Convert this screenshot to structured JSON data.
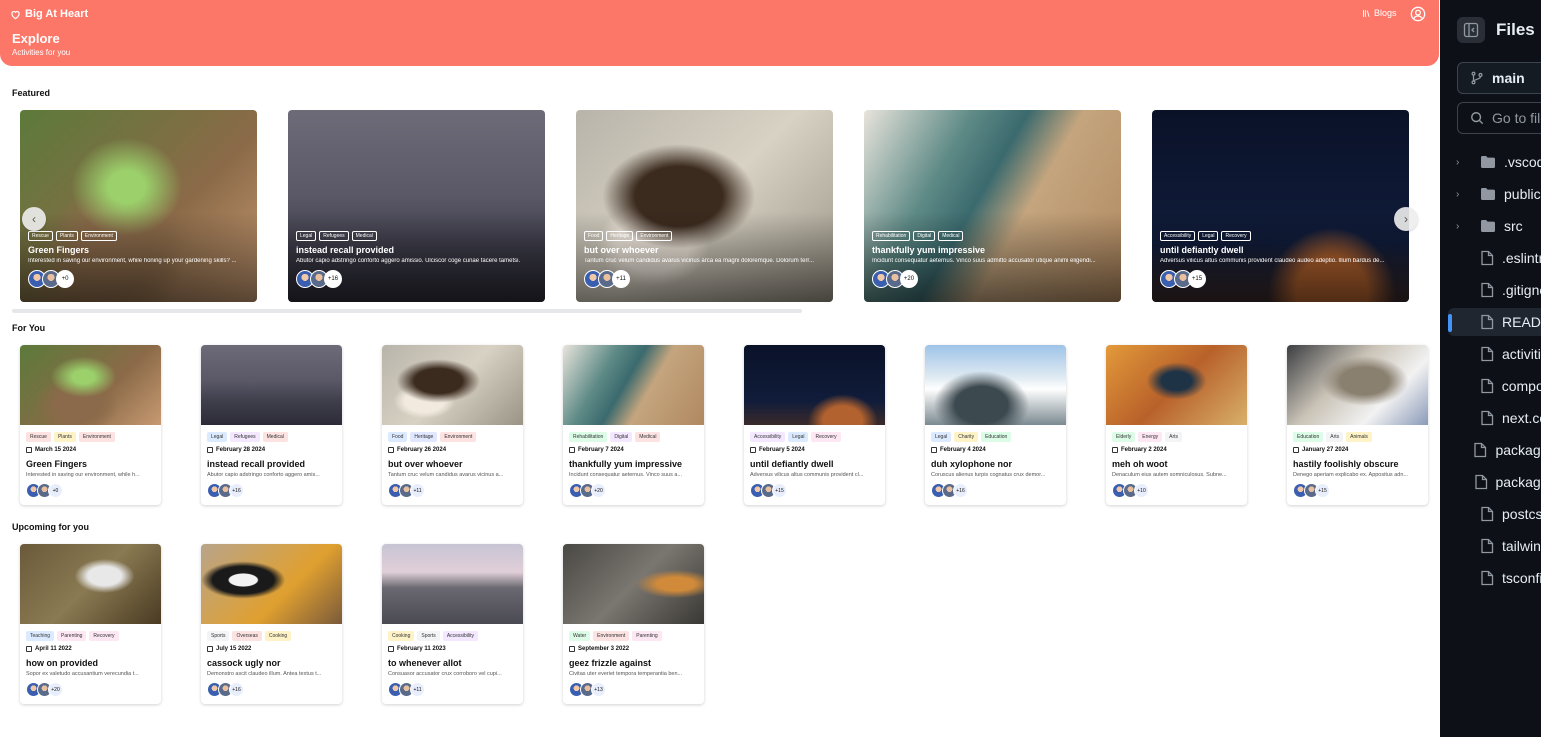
{
  "header": {
    "brand": "Big At Heart",
    "title": "Explore",
    "subtitle": "Activities for you",
    "blogs": "Blogs"
  },
  "sections": {
    "featured": "Featured",
    "for_you": "For You",
    "upcoming": "Upcoming for you"
  },
  "featured": [
    {
      "title": "Green Fingers",
      "desc": "Interested in saving our environment, while honing up your gardening skills? ...",
      "tags": [
        "Rescue",
        "Plants",
        "Environment"
      ],
      "count": "+0"
    },
    {
      "title": "instead recall provided",
      "desc": "Abutor capio adstringo conforto aggero amissio. Ulciscor coge cunae facere tametsi.",
      "tags": [
        "Legal",
        "Refugees",
        "Medical"
      ],
      "count": "+16"
    },
    {
      "title": "but over whoever",
      "desc": "Tantum cruc velum candidus avarus vicinus arca ea magni doloremque. Dolorum terr...",
      "tags": [
        "Food",
        "Heritage",
        "Environment"
      ],
      "count": "+11"
    },
    {
      "title": "thankfully yum impressive",
      "desc": "Incidunt consequatur aeternus. Vinco suus admitto accusator utique animi eligendi...",
      "tags": [
        "Rehabilitation",
        "Digital",
        "Medical"
      ],
      "count": "+20"
    },
    {
      "title": "until defiantly dwell",
      "desc": "Adversus vilicus altus communis provident claudeo audeo adeptio. Illum bardus de...",
      "tags": [
        "Accessibility",
        "Legal",
        "Recovery"
      ],
      "count": "+15"
    }
  ],
  "for_you": [
    {
      "title": "Green Fingers",
      "date": "March 15 2024",
      "desc": "Interested in saving our environment, while h...",
      "tags": [
        "Rescue",
        "Plants",
        "Environment"
      ],
      "count": "+0"
    },
    {
      "title": "instead recall provided",
      "date": "February 28 2024",
      "desc": "Abutor capio adstringo conforto aggero amis...",
      "tags": [
        "Legal",
        "Refugees",
        "Medical"
      ],
      "count": "+16"
    },
    {
      "title": "but over whoever",
      "date": "February 26 2024",
      "desc": "Tantum cruc velum candidus avarus vicinus a...",
      "tags": [
        "Food",
        "Heritage",
        "Environment"
      ],
      "count": "+11"
    },
    {
      "title": "thankfully yum impressive",
      "date": "February 7 2024",
      "desc": "Incidunt consequatur aeternus. Vinco suus a...",
      "tags": [
        "Rehabilitation",
        "Digital",
        "Medical"
      ],
      "count": "+20"
    },
    {
      "title": "until defiantly dwell",
      "date": "February 5 2024",
      "desc": "Adversus vilicus altus communis provident cl...",
      "tags": [
        "Accessibility",
        "Legal",
        "Recovery"
      ],
      "count": "+15"
    },
    {
      "title": "duh xylophone nor",
      "date": "February 4 2024",
      "desc": "Coruscus alienus turpis cognatus crux demor...",
      "tags": [
        "Legal",
        "Charity",
        "Education"
      ],
      "count": "+16"
    },
    {
      "title": "meh oh woot",
      "date": "February 2 2024",
      "desc": "Denaculum eius autem somniculosus. Subne...",
      "tags": [
        "Elderly",
        "Energy",
        "Arts"
      ],
      "count": "+10"
    },
    {
      "title": "hastily foolishly obscure",
      "date": "January 27 2024",
      "desc": "Denego aperiam explicabo ex. Appositus adn...",
      "tags": [
        "Education",
        "Arts",
        "Animals"
      ],
      "count": "+15"
    }
  ],
  "upcoming": [
    {
      "title": "how on provided",
      "date": "April 11 2022",
      "desc": "Sopor ex valetudo accusantium verecundia t...",
      "tags": [
        "Teaching",
        "Parenting",
        "Recovery"
      ],
      "count": "+20"
    },
    {
      "title": "cassock ugly nor",
      "date": "July 15 2022",
      "desc": "Demonstro ascit claudeo illum. Antea textus t...",
      "tags": [
        "Sports",
        "Overseas",
        "Cooking"
      ],
      "count": "+16"
    },
    {
      "title": "to whenever allot",
      "date": "February 11 2023",
      "desc": "Consuasor accusator crux corroboro vel cupi...",
      "tags": [
        "Cooking",
        "Sports",
        "Accessibility"
      ],
      "count": "+11"
    },
    {
      "title": "geez frizzle against",
      "date": "September 3 2022",
      "desc": "Civitas uter everiet tempora temperantia ben...",
      "tags": [
        "Water",
        "Environment",
        "Parenting"
      ],
      "count": "+13"
    }
  ],
  "sidebar": {
    "title": "Files",
    "branch": "main",
    "search_placeholder": "Go to file",
    "items": [
      {
        "name": ".vscode",
        "type": "folder"
      },
      {
        "name": "public",
        "type": "folder"
      },
      {
        "name": "src",
        "type": "folder"
      },
      {
        "name": ".eslintrc",
        "type": "file"
      },
      {
        "name": ".gitignore",
        "type": "file"
      },
      {
        "name": "README",
        "type": "file"
      },
      {
        "name": "activities",
        "type": "file"
      },
      {
        "name": "components",
        "type": "file"
      },
      {
        "name": "next.config",
        "type": "file"
      },
      {
        "name": "package.json",
        "type": "file"
      },
      {
        "name": "package-lock",
        "type": "file"
      },
      {
        "name": "postcss",
        "type": "file"
      },
      {
        "name": "tailwind",
        "type": "file"
      },
      {
        "name": "tsconfig",
        "type": "file"
      }
    ]
  },
  "colors": {
    "header": "#fd7769",
    "sidebar_bg": "#0d1117",
    "accent": "#4493f8"
  }
}
